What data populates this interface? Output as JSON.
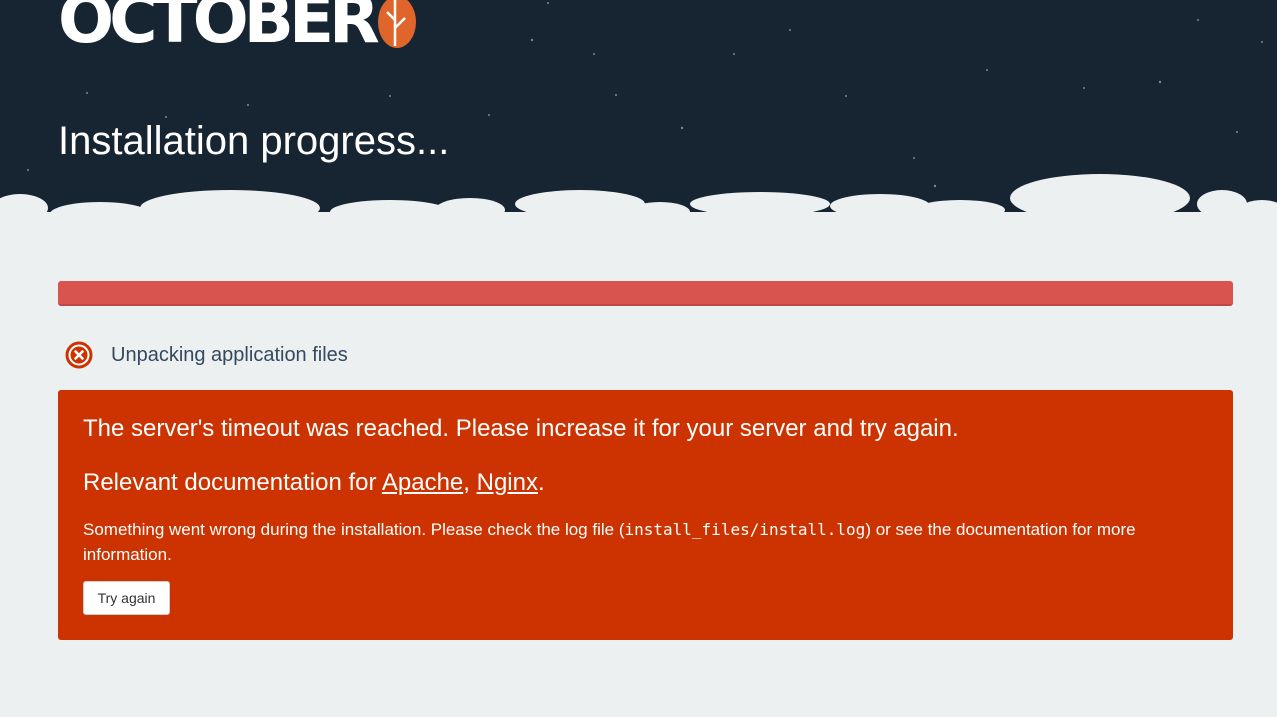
{
  "brand": {
    "logo_text": "OCTOBER",
    "leaf_color": "#e0652b"
  },
  "header": {
    "title": "Installation progress...",
    "background_color": "#172431"
  },
  "progress": {
    "value_percent": 100,
    "status": "error",
    "color": "#d9534f"
  },
  "step": {
    "icon": "error-circle-x-icon",
    "label": "Unpacking application files",
    "icon_color": "#cc3300"
  },
  "error": {
    "background_color": "#cc3300",
    "title": "The server's timeout was reached. Please increase it for your server and try again.",
    "docs_prefix": "Relevant documentation for ",
    "docs_link_apache": "Apache",
    "docs_separator": ", ",
    "docs_link_nginx": "Nginx",
    "docs_suffix": ".",
    "message_before": "Something went wrong during the installation. Please check the log file (",
    "message_code": "install_files/install.log",
    "message_after": ") or see the documentation for more information.",
    "button_label": "Try again"
  }
}
